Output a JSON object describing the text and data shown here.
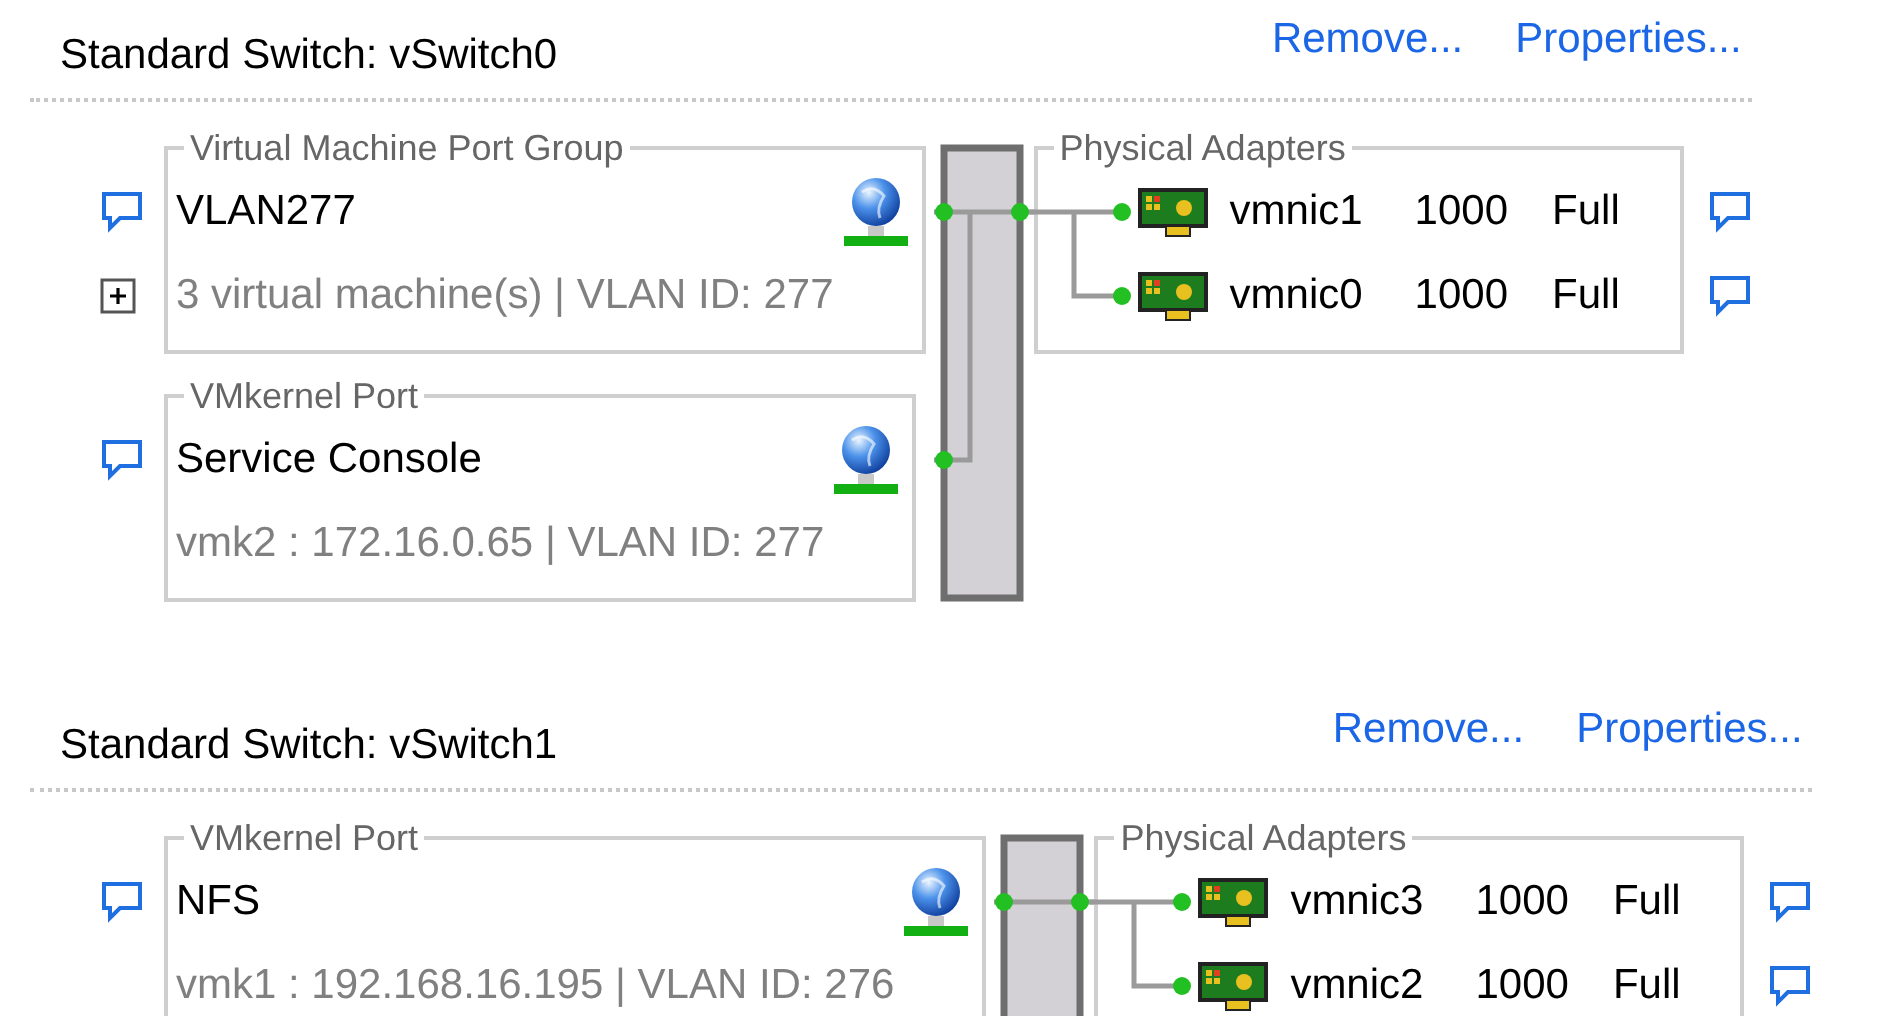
{
  "switches": [
    {
      "title": "Standard Switch: vSwitch0",
      "actions": [
        "Remove...",
        "Properties..."
      ],
      "port_groups": [
        {
          "type": "Virtual Machine Port Group",
          "name": "VLAN277",
          "detail": "3 virtual machine(s) | VLAN ID: 277",
          "expanded": false
        },
        {
          "type": "VMkernel Port",
          "name": "Service Console",
          "detail": "vmk2 : 172.16.0.65 | VLAN ID: 277"
        }
      ],
      "adapters_label": "Physical Adapters",
      "adapters": [
        {
          "name": "vmnic1",
          "speed": "1000",
          "duplex": "Full"
        },
        {
          "name": "vmnic0",
          "speed": "1000",
          "duplex": "Full"
        }
      ]
    },
    {
      "title": "Standard Switch: vSwitch1",
      "actions": [
        "Remove...",
        "Properties..."
      ],
      "port_groups": [
        {
          "type": "VMkernel Port",
          "name": "NFS",
          "detail": "vmk1 : 192.168.16.195 | VLAN ID: 276"
        }
      ],
      "adapters_label": "Physical Adapters",
      "adapters": [
        {
          "name": "vmnic3",
          "speed": "1000",
          "duplex": "Full"
        },
        {
          "name": "vmnic2",
          "speed": "1000",
          "duplex": "Full"
        }
      ]
    }
  ]
}
